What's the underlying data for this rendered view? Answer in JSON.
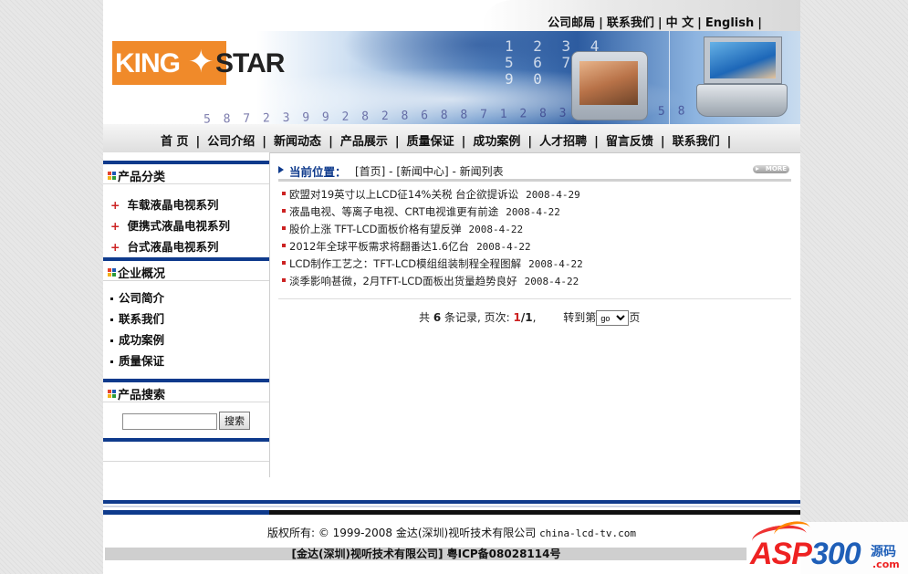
{
  "header": {
    "top_links": [
      "公司邮局",
      "联系我们",
      "中 文",
      "English"
    ],
    "logo": "KING STAR",
    "banner_digits": "1 2 3 4 5 6 7 8 9 0",
    "banner_number_strip": "5 8 7 2 3 9 9 2 8 2 8 6 8 8 7 1 2 8 3 7 0 1 9 5 8 0 6 5 2 3"
  },
  "nav": {
    "items": [
      "首 页",
      "公司介绍",
      "新闻动态",
      "产品展示",
      "质量保证",
      "成功案例",
      "人才招聘",
      "留言反馈",
      "联系我们"
    ]
  },
  "sidebar": {
    "products_title": "产品分类",
    "products": [
      "车载液晶电视系列",
      "便携式液晶电视系列",
      "台式液晶电视系列"
    ],
    "company_title": "企业概况",
    "company": [
      "公司简介",
      "联系我们",
      "成功案例",
      "质量保证"
    ],
    "search_title": "产品搜索",
    "search_placeholder": "",
    "search_button": "搜索"
  },
  "main": {
    "location_label": "当前位置：",
    "breadcrumb": "[首页] - [新闻中心] - 新闻列表",
    "more_label": "MORE",
    "news": [
      {
        "title": "欧盟对19英寸以上LCD征14%关税 台企欲提诉讼",
        "date": "2008-4-29"
      },
      {
        "title": "液晶电视、等离子电视、CRT电视谁更有前途",
        "date": "2008-4-22"
      },
      {
        "title": "股价上涨 TFT-LCD面板价格有望反弹",
        "date": "2008-4-22"
      },
      {
        "title": "2012年全球平板需求将翻番达1.6亿台",
        "date": "2008-4-22"
      },
      {
        "title": "LCD制作工艺之：TFT-LCD模组组装制程全程图解",
        "date": "2008-4-22"
      },
      {
        "title": "淡季影响甚微，2月TFT-LCD面板出货量趋势良好",
        "date": "2008-4-22"
      }
    ],
    "pager": {
      "prefix": "共",
      "total": "6",
      "records_label": "条记录, 页次:",
      "current": "1",
      "total_pages": "/1",
      "suffix": ",",
      "goto_label": "转到第",
      "select_value": "go",
      "page_label": "页"
    }
  },
  "footer": {
    "copyright": "版权所有: © 1999-2008 金达(深圳)视听技术有限公司",
    "url": "china-lcd-tv.com",
    "icp": "[金达(深圳)视听技术有限公司] 粤ICP备08028114号"
  },
  "watermark": {
    "brand_a": "ASP",
    "brand_b": "300",
    "cn": "源码",
    "com": ".com"
  },
  "colors": {
    "accent_blue": "#0e3a8c",
    "bullet_red": "#cc2222",
    "logo_orange": "#f08a2a"
  }
}
